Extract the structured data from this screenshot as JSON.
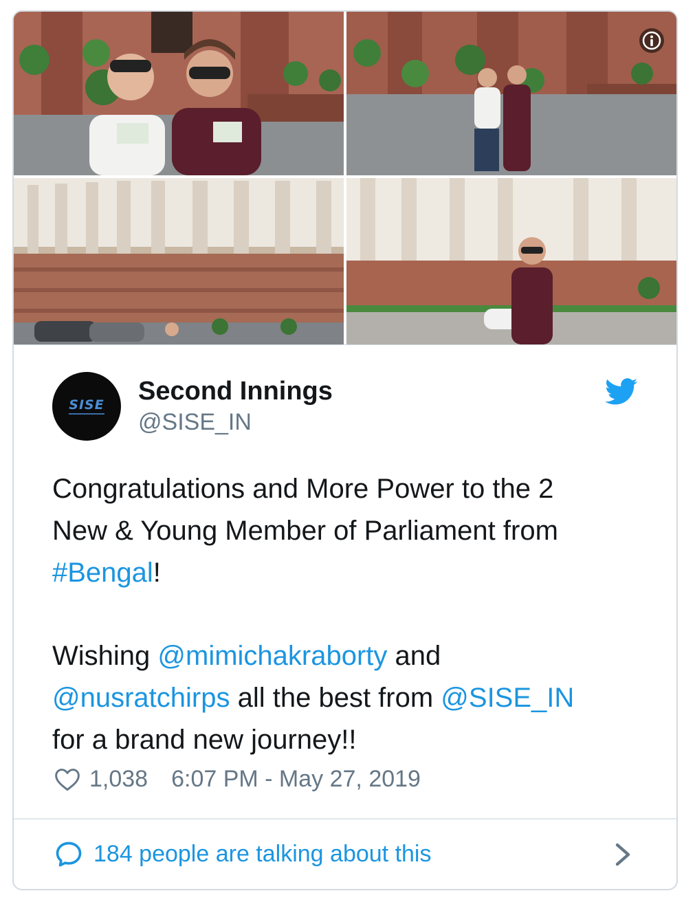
{
  "tweet": {
    "author": {
      "name": "Second Innings",
      "handle": "@SISE_IN",
      "avatar_text": "SISE"
    },
    "text": {
      "line1": "Congratulations and More Power to the 2",
      "line2": "New & Young Member of Parliament from",
      "line3_hashtag": "#Bengal",
      "line3_rest": "!",
      "line4_pre": "Wishing ",
      "line4_mention": "@mimichakraborty",
      "line4_post": " and",
      "line5_mention1": "@nusratchirps",
      "line5_mid": " all the best from ",
      "line5_mention2": "@SISE_IN",
      "line6": "for a brand new journey!!"
    },
    "likes": "1,038",
    "timestamp": "6:07 PM - May 27, 2019",
    "footer_text": "184 people are talking about this",
    "icons": {
      "info": "info-icon",
      "bird": "twitter-bird-icon",
      "like": "heart-icon",
      "comment": "speech-bubble-icon",
      "chevron": "chevron-right-icon"
    },
    "colors": {
      "link": "#1b95e0",
      "secondary_text": "#657786",
      "primary_text": "#14171a",
      "border": "#d4dbe1"
    }
  }
}
